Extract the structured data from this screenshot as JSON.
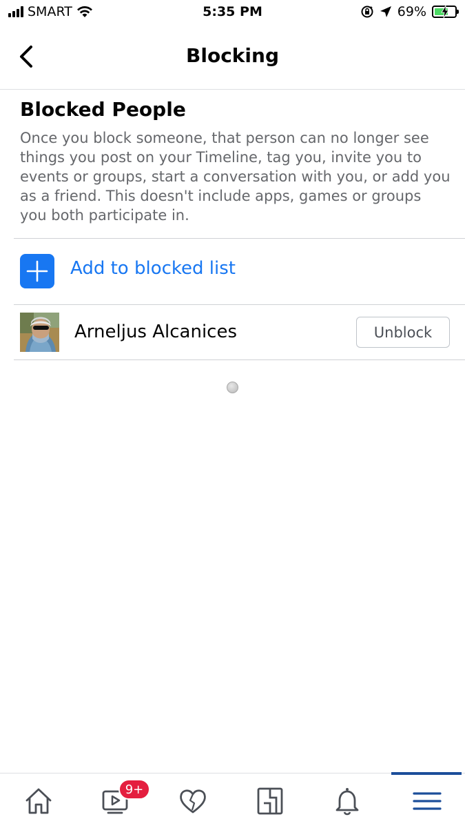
{
  "status_bar": {
    "carrier": "SMART",
    "time": "5:35 PM",
    "battery_percent": "69%",
    "battery_level": 0.69,
    "icons": [
      "signal-icon",
      "wifi-icon",
      "orientation-lock-icon",
      "location-arrow-icon",
      "battery-icon"
    ]
  },
  "header": {
    "title": "Blocking",
    "back_icon": "chevron-left-icon"
  },
  "blocked_people": {
    "title": "Blocked People",
    "description": "Once you block someone, that person can no longer see things you post on your Timeline, tag you, invite you to events or groups, start a conversation with you, or add you as a friend. This doesn't include apps, games or groups you both participate in.",
    "add_label": "Add to blocked list",
    "add_icon": "plus-icon",
    "list": [
      {
        "name": "Arneljus Alcanices",
        "action_label": "Unblock"
      }
    ]
  },
  "tab_bar": {
    "tabs": [
      {
        "name": "home",
        "icon": "home-icon"
      },
      {
        "name": "watch",
        "icon": "video-icon",
        "badge": "9+"
      },
      {
        "name": "dating",
        "icon": "heart-icon"
      },
      {
        "name": "pages",
        "icon": "pages-icon"
      },
      {
        "name": "notifications",
        "icon": "bell-icon"
      },
      {
        "name": "menu",
        "icon": "menu-icon",
        "active": true
      }
    ]
  },
  "colors": {
    "accent": "#1877f2",
    "badge": "#e41e3f",
    "active_tab": "#1c4e9a",
    "secondary_text": "#65676b"
  }
}
